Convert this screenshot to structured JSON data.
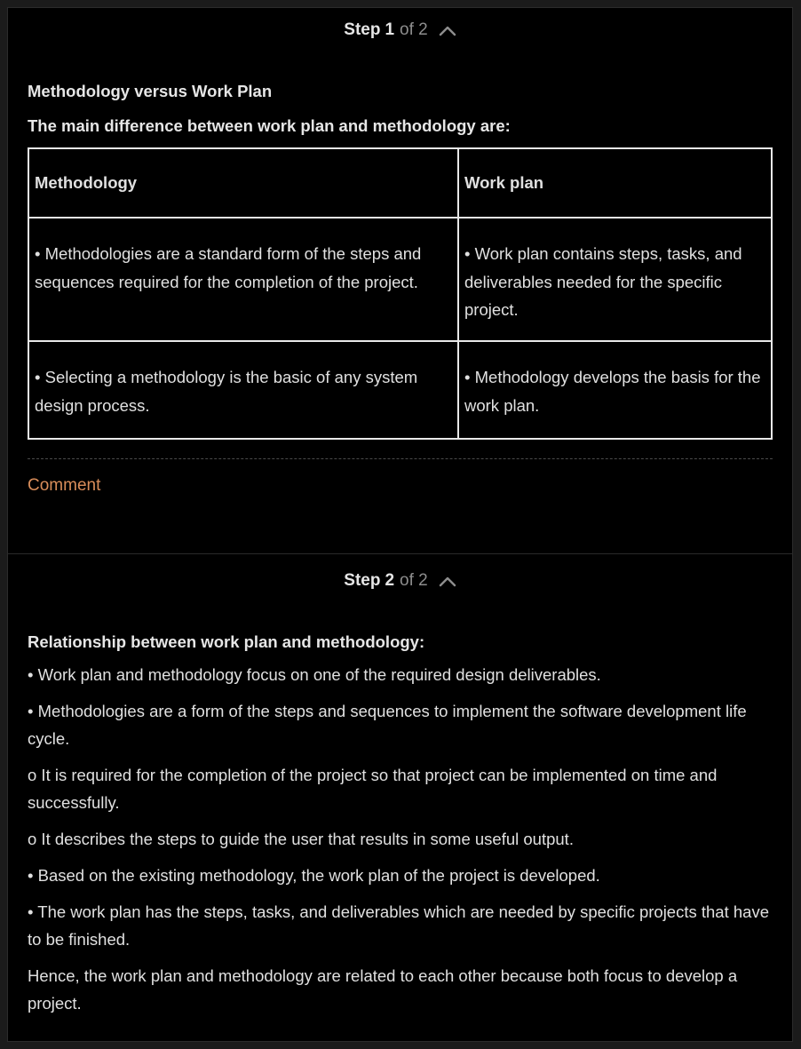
{
  "step1": {
    "header": {
      "step_word": "Step",
      "step_num": "1",
      "of_text": "of 2"
    },
    "title1": "Methodology versus Work Plan",
    "title2": "The main difference between work plan and methodology are:",
    "table": {
      "headers": [
        "Methodology",
        "Work plan"
      ],
      "rows": [
        [
          "• Methodologies are a standard form of the steps and sequences required for the completion of the project.",
          "• Work plan contains steps, tasks, and deliverables needed for the specific project."
        ],
        [
          "• Selecting a methodology is the basic of any system design process.",
          "• Methodology develops the basis for the work plan."
        ]
      ]
    },
    "comment_label": "Comment"
  },
  "step2": {
    "header": {
      "step_word": "Step",
      "step_num": "2",
      "of_text": "of 2"
    },
    "title": "Relationship between work plan and methodology:",
    "paragraphs": [
      "• Work plan and methodology focus on one of the required design deliverables.",
      "• Methodologies are a form of the steps and sequences to implement the software development life cycle.",
      "o It is required for the completion of the project so that project can be implemented on time and successfully.",
      "o It describes the steps to guide the user that results in some useful output.",
      "• Based on the existing methodology, the work plan of the project is developed.",
      "• The work plan has the steps, tasks, and deliverables which are needed by specific projects that have to be finished.",
      "Hence, the work plan and methodology are related to each other because both focus to develop a project."
    ]
  },
  "colors": {
    "background": "#000000",
    "text": "#e6e6e6",
    "muted": "#8d8d8d",
    "comment_link": "#d98d5a",
    "table_border": "#e8e8e8"
  },
  "icons": {
    "collapse": "chevron-up-icon"
  }
}
